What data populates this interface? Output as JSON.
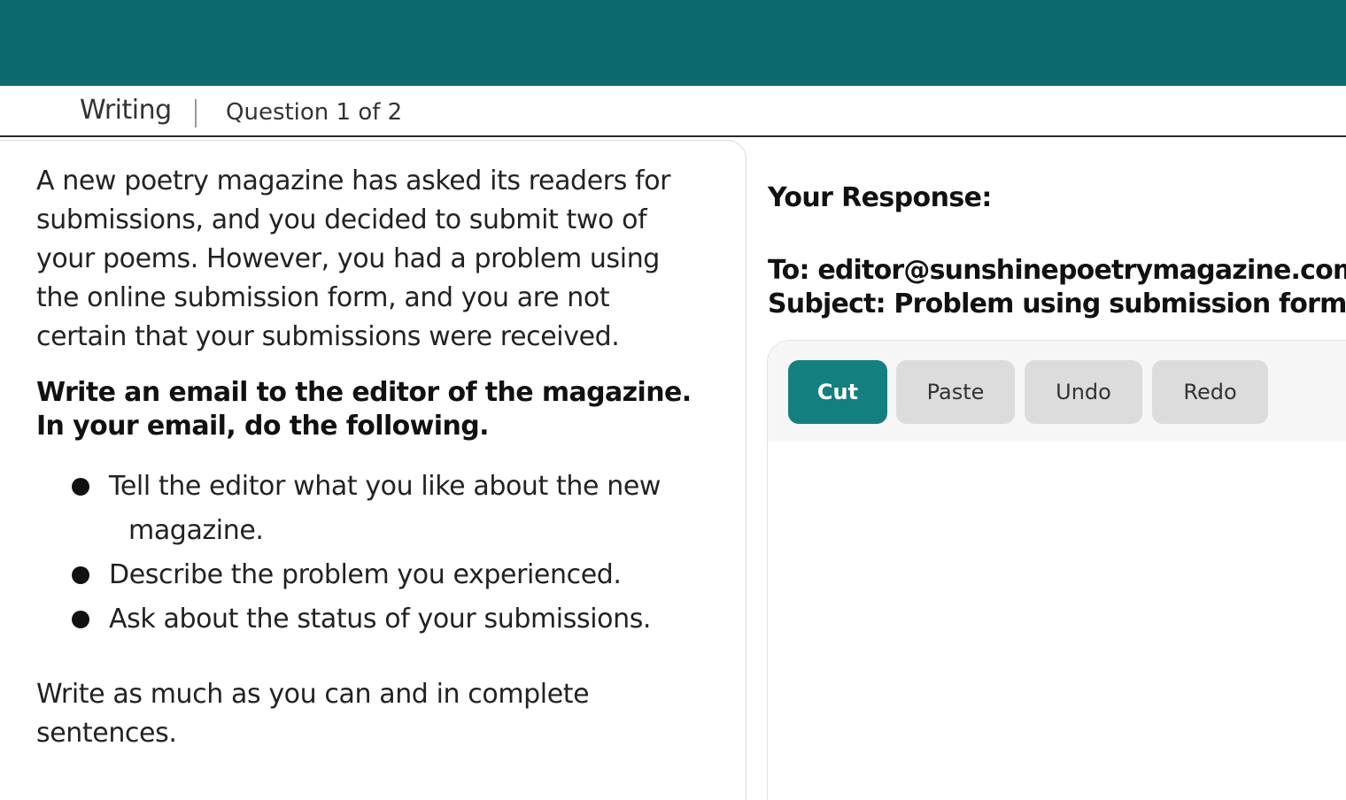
{
  "header": {
    "section": "Writing",
    "separator": "|",
    "question_counter": "Question 1 of 2"
  },
  "prompt": {
    "intro": "A new poetry magazine has asked its readers for submissions, and you decided to submit two of your poems.  However, you had a problem using the online submission form, and you are not certain that your submissions were received.",
    "instruction": "Write an email to the editor of the magazine.  In your email, do the following.",
    "tasks": [
      {
        "line1": "Tell the editor what you like about the new",
        "line2": "magazine."
      },
      {
        "text": "Describe the problem you experienced."
      },
      {
        "text": "Ask about the status of your submissions."
      }
    ],
    "closing": "Write as much as you can and in complete sentences."
  },
  "response": {
    "label": "Your Response:",
    "to": "To: editor@sunshinepoetrymagazine.com",
    "subject": "Subject: Problem using submission form",
    "value": ""
  },
  "toolbar": {
    "cut": "Cut",
    "paste": "Paste",
    "undo": "Undo",
    "redo": "Redo"
  },
  "colors": {
    "top_bar": "#0c6a6e",
    "cut_button": "#13807f",
    "button_default": "#dcdcdc"
  }
}
